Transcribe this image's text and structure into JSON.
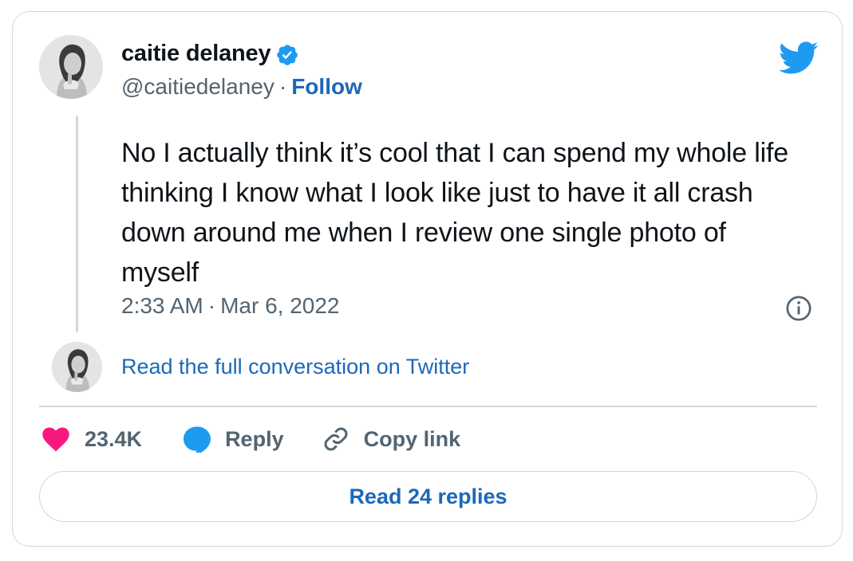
{
  "author": {
    "display_name": "caitie delaney",
    "handle": "@caitiedelaney",
    "separator": "·",
    "follow_label": "Follow",
    "verified": true
  },
  "tweet": {
    "text": "No I actually think it’s cool that I can spend my whole life thinking I know what I look like just to have it all crash down around me when I review one single photo of myself",
    "time": "2:33 AM",
    "separator": "·",
    "date": "Mar 6, 2022"
  },
  "conversation_link": "Read the full conversation on Twitter",
  "actions": {
    "like_count": "23.4K",
    "reply_label": "Reply",
    "copy_link_label": "Copy link"
  },
  "read_replies_label": "Read 24 replies",
  "icons": {
    "verified": "verified-badge-icon",
    "logo": "twitter-bird-icon",
    "info": "info-icon",
    "like": "heart-icon",
    "reply": "speech-bubble-icon",
    "copy": "link-icon"
  },
  "colors": {
    "link": "#1d68b8",
    "twitter_blue": "#1d9bf0",
    "heart": "#f91880",
    "muted": "#536471",
    "border": "#cfd9de"
  }
}
